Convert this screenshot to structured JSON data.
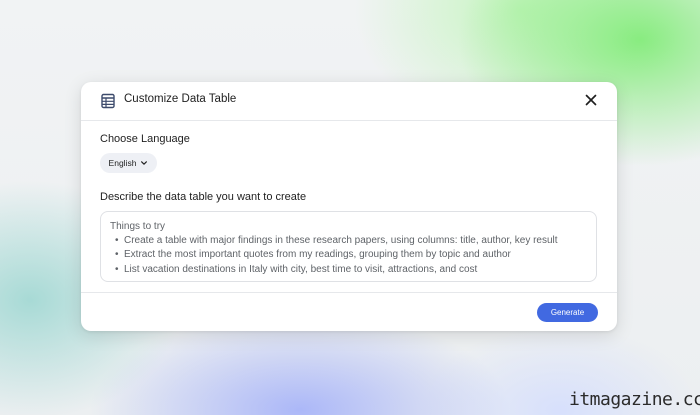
{
  "dialog": {
    "title": "Customize Data Table",
    "language_label": "Choose Language",
    "language_value": "English",
    "describe_label": "Describe the data table you want to create",
    "suggestions": {
      "heading": "Things to try",
      "items": [
        "Create a table with major findings in these research papers, using columns: title, author, key result",
        "Extract the most important quotes from my readings, grouping them by topic and author",
        "List vacation destinations in Italy with city, best time to visit, attractions, and cost"
      ]
    },
    "generate_label": "Generate"
  },
  "watermark": "itmagazine.cc",
  "icons": {
    "header": "table-icon",
    "close": "close-icon",
    "dropdown": "chevron-down-icon"
  },
  "colors": {
    "primary_button": "#4169e1",
    "chip_bg": "#eef0f5"
  }
}
